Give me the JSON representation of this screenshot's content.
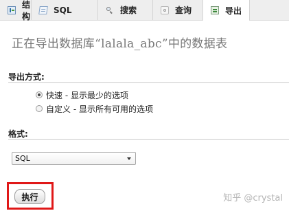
{
  "tabs": [
    {
      "label": "结构",
      "icon": "structure-icon",
      "active": false
    },
    {
      "label": "SQL",
      "icon": "sql-icon",
      "active": false
    },
    {
      "label": "搜索",
      "icon": "search-icon",
      "active": false
    },
    {
      "label": "查询",
      "icon": "query-icon",
      "active": false
    },
    {
      "label": "导出",
      "icon": "export-icon",
      "active": true
    }
  ],
  "page": {
    "title": "正在导出数据库“lalala_abc”中的数据表"
  },
  "export_method": {
    "label": "导出方式:",
    "options": [
      {
        "label": "快速 - 显示最少的选项",
        "checked": true
      },
      {
        "label": "自定义 - 显示所有可用的选项",
        "checked": false
      }
    ]
  },
  "format": {
    "label": "格式:",
    "selected": "SQL"
  },
  "actions": {
    "execute_label": "执行"
  },
  "watermark": {
    "text": "知乎 @crystal"
  },
  "colors": {
    "highlight_border": "#e01818",
    "tab_bar_background": "#eeeeee",
    "title_text": "#777777"
  }
}
